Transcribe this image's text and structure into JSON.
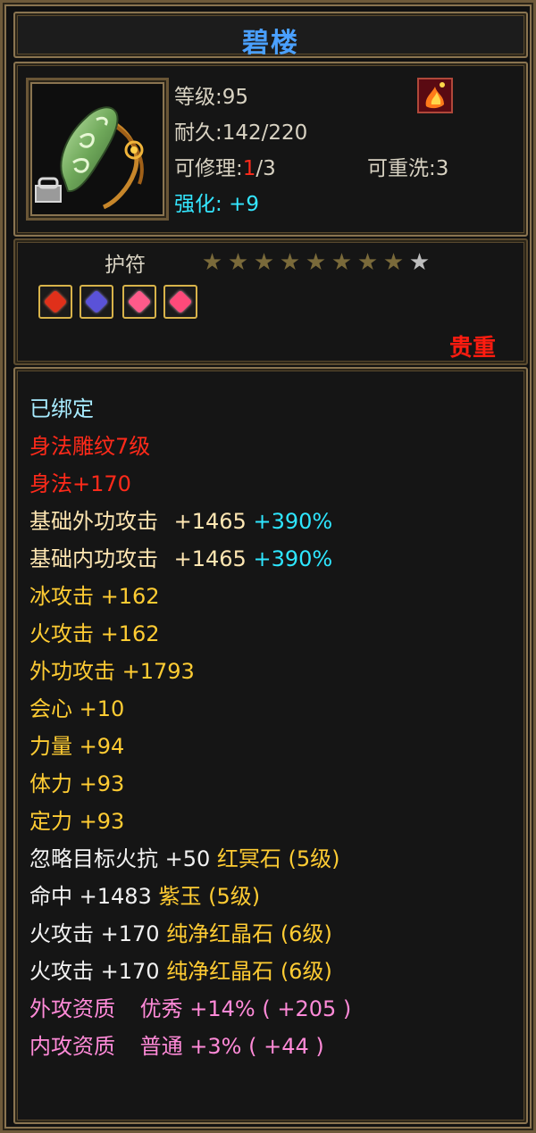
{
  "item": {
    "name": "碧楼",
    "level": "等级:95",
    "durability": "耐久:142/220",
    "repair_prefix": "可修理:",
    "repair_current": "1",
    "repair_suffix": "/3",
    "rewash": "可重洗:3",
    "enhance_label": "强化:",
    "enhance_value": "+9",
    "type_label": "护符",
    "stars_lit": 8,
    "stars_total": 9,
    "quality": "贵重",
    "gems": [
      "red-gem",
      "purple-gem",
      "pink-gem",
      "pink-gem"
    ]
  },
  "attributes": {
    "bound": "已绑定",
    "carve": "身法雕纹7级",
    "carve_bonus": "身法+170",
    "base_outer_label": "基础外功攻击",
    "base_outer_value": "+1465",
    "base_outer_pct": "+390%",
    "base_inner_label": "基础内功攻击",
    "base_inner_value": "+1465",
    "base_inner_pct": "+390%",
    "ice_attack": "冰攻击  +162",
    "fire_attack": "火攻击  +162",
    "outer_attack": "外功攻击  +1793",
    "crit": "会心  +10",
    "strength": "力量  +94",
    "vitality": "体力  +93",
    "focus": "定力  +93",
    "ignore_fire_res": "忽略目标火抗  +50",
    "gem1_name": "红冥石 (5级)",
    "hit": "命中  +1483",
    "gem2_name": "紫玉 (5级)",
    "fire_gem3": "火攻击  +170",
    "gem3_name": "纯净红晶石 (6级)",
    "fire_gem4": "火攻击  +170",
    "gem4_name": "纯净红晶石 (6级)",
    "outer_quality_label": "外攻资质",
    "outer_quality_grade": "优秀",
    "outer_quality_bonus": "+14% ( +205 )",
    "inner_quality_label": "内攻资质",
    "inner_quality_grade": "普通",
    "inner_quality_bonus": "+3% ( +44 )"
  },
  "colors": {
    "title": "#4aa0ff",
    "frame": "#8a7450",
    "quality": "#ff1c10",
    "pink": "#ff8ad8"
  }
}
